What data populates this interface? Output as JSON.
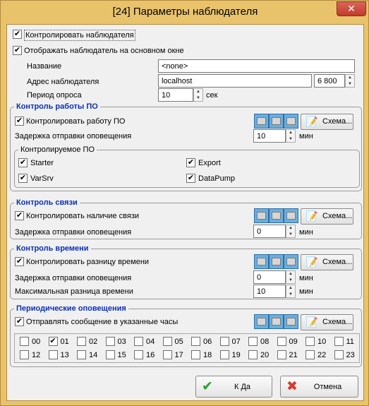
{
  "window": {
    "title": "[24] Параметры наблюдателя",
    "close_glyph": "✕"
  },
  "general": {
    "control_observer": "Контролировать наблюдателя",
    "show_on_main": "Отображать наблюдатель на основном окне",
    "name_label": "Название",
    "name_value": "<none>",
    "address_label": "Адрес наблюдателя",
    "address_value": "localhost",
    "port_value": "6 800",
    "period_label": "Период опроса",
    "period_value": "10",
    "period_unit": "сек"
  },
  "software": {
    "title": "Контроль работы ПО",
    "control_label": "Контролировать работу ПО",
    "delay_label": "Задержка отправки оповещения",
    "delay_value": "10",
    "unit": "мин",
    "scheme_label": "Схема...",
    "sub_title": "Контролируемое ПО",
    "items": [
      "Starter",
      "VarSrv",
      "Export",
      "DataPump"
    ]
  },
  "link": {
    "title": "Контроль связи",
    "control_label": "Контролировать наличие связи",
    "delay_label": "Задержка отправки оповещения",
    "delay_value": "0",
    "unit": "мин",
    "scheme_label": "Схема..."
  },
  "time": {
    "title": "Контроль времени",
    "control_label": "Контролировать разницу времени",
    "delay_label": "Задержка отправки оповещения",
    "delay_value": "0",
    "max_label": "Максимальная разница времени",
    "max_value": "10",
    "unit": "мин",
    "scheme_label": "Схема..."
  },
  "periodic": {
    "title": "Периодические оповещения",
    "send_label": "Отправлять сообщение в указанные часы",
    "scheme_label": "Схема...",
    "hours": [
      "00",
      "01",
      "02",
      "03",
      "04",
      "05",
      "06",
      "07",
      "08",
      "09",
      "10",
      "11",
      "12",
      "13",
      "14",
      "15",
      "16",
      "17",
      "18",
      "19",
      "20",
      "21",
      "22",
      "23"
    ],
    "checked_hours": [
      "01"
    ]
  },
  "footer": {
    "ok_label": "К Да",
    "cancel_label": "Отмена"
  },
  "check_glyph": "✔"
}
